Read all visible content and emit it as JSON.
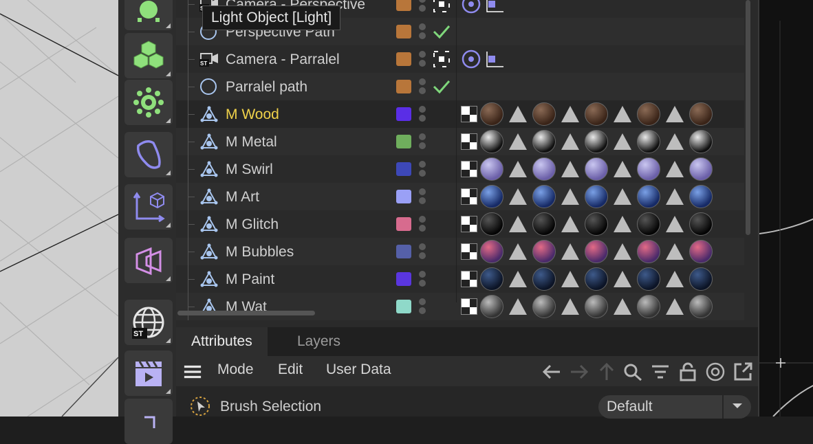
{
  "tooltip": "Light Object [Light]",
  "objects": [
    {
      "name": "Camera - Perspective",
      "color": "#b8763a",
      "flag": "target"
    },
    {
      "name": "Perspective Path",
      "color": "#b8763a",
      "flag": "check"
    },
    {
      "name": "Camera - Parralel",
      "color": "#b8763a",
      "flag": "target"
    },
    {
      "name": "Parralel path",
      "color": "#b8763a",
      "flag": "check"
    },
    {
      "name": "M Wood",
      "color": "#5a2ee6",
      "material": "wood"
    },
    {
      "name": "M Metal",
      "color": "#6fae5d",
      "material": "metal"
    },
    {
      "name": "M Swirl",
      "color": "#3d48b8",
      "material": "swirl"
    },
    {
      "name": "M Art",
      "color": "#9aa0f6",
      "material": "art"
    },
    {
      "name": "M Glitch",
      "color": "#d76b8e",
      "material": "glitch"
    },
    {
      "name": "M Bubbles",
      "color": "#5560a8",
      "material": "bubbles"
    },
    {
      "name": "M Paint",
      "color": "#5a36df",
      "material": "paint"
    },
    {
      "name": "M Wat",
      "color": "#8fd9c9",
      "material": "water"
    }
  ],
  "attributes": {
    "tabs": [
      "Attributes",
      "Layers"
    ],
    "menus": [
      "Mode",
      "Edit",
      "User Data"
    ],
    "brush_label": "Brush Selection",
    "preset": "Default"
  },
  "palette_icons": [
    "light-icon",
    "cube-cluster-icon",
    "gear-generator-icon",
    "deformer-icon",
    "coordinate-icon",
    "mograph-icon",
    "globe-icon",
    "clapper-icon",
    "tool-icon"
  ],
  "colors": {
    "accent_yellow": "#f0d24a",
    "check_green": "#7fd77b",
    "target_purple": "#8f8bef"
  }
}
